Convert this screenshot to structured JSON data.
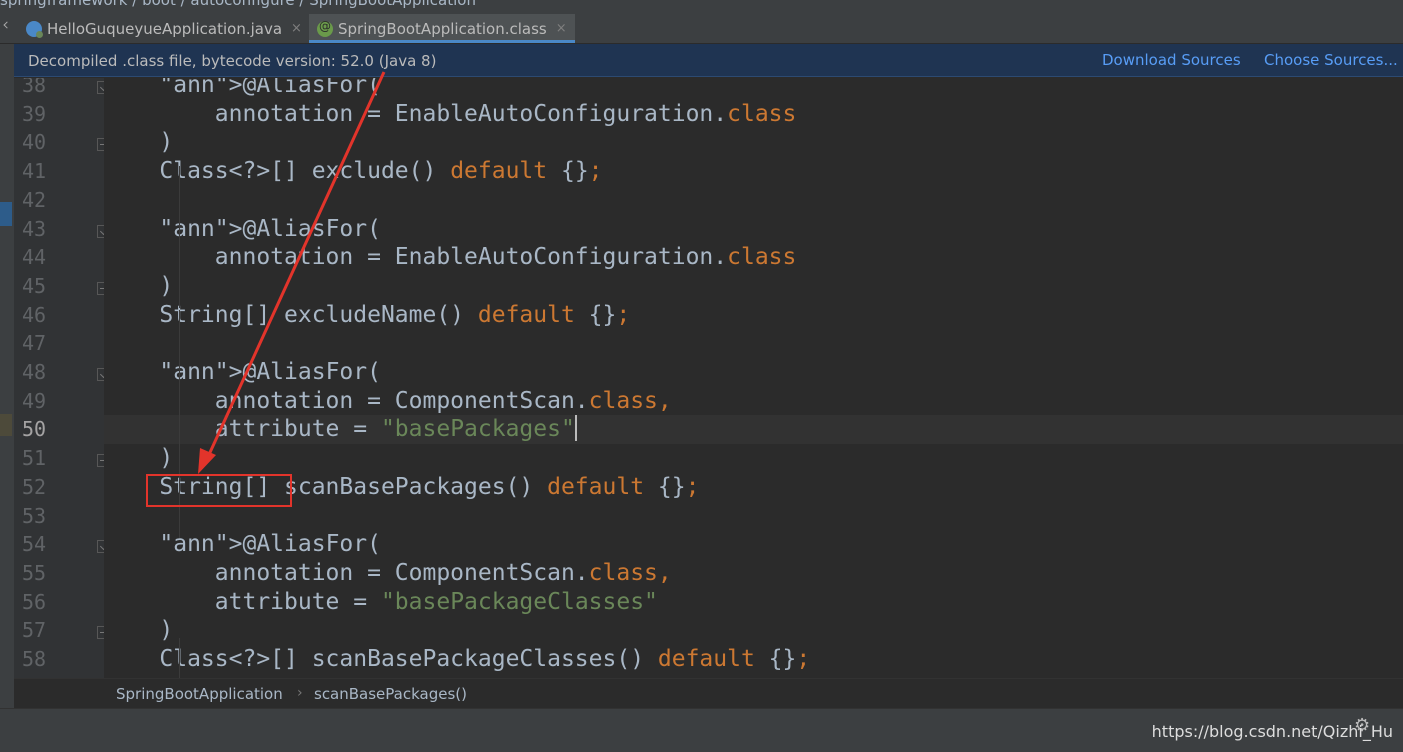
{
  "breadcrumb_top": "springframework  /  boot  /  autoconfigure  /  SpringBootApplication",
  "tabs": [
    {
      "label": "HelloGuqueyueApplication.java",
      "close": "×"
    },
    {
      "label": "SpringBootApplication.class",
      "close": "×"
    }
  ],
  "notification": {
    "message": "Decompiled .class file, bytecode version: 52.0 (Java 8)",
    "download_sources": "Download Sources",
    "choose_sources": "Choose Sources..."
  },
  "editor": {
    "current_line": 50,
    "lines": [
      {
        "n": "38",
        "t": "    @AliasFor("
      },
      {
        "n": "39",
        "t": "        annotation = EnableAutoConfiguration.class"
      },
      {
        "n": "40",
        "t": "    )"
      },
      {
        "n": "41",
        "t": "    Class<?>[] exclude() default {};"
      },
      {
        "n": "42",
        "t": ""
      },
      {
        "n": "43",
        "t": "    @AliasFor("
      },
      {
        "n": "44",
        "t": "        annotation = EnableAutoConfiguration.class"
      },
      {
        "n": "45",
        "t": "    )"
      },
      {
        "n": "46",
        "t": "    String[] excludeName() default {};"
      },
      {
        "n": "47",
        "t": ""
      },
      {
        "n": "48",
        "t": "    @AliasFor("
      },
      {
        "n": "49",
        "t": "        annotation = ComponentScan.class,"
      },
      {
        "n": "50",
        "t": "        attribute = \"basePackages\""
      },
      {
        "n": "51",
        "t": "    )"
      },
      {
        "n": "52",
        "t": "    String[] scanBasePackages() default {};"
      },
      {
        "n": "53",
        "t": ""
      },
      {
        "n": "54",
        "t": "    @AliasFor("
      },
      {
        "n": "55",
        "t": "        annotation = ComponentScan.class,"
      },
      {
        "n": "56",
        "t": "        attribute = \"basePackageClasses\""
      },
      {
        "n": "57",
        "t": "    )"
      },
      {
        "n": "58",
        "t": "    Class<?>[] scanBasePackageClasses() default {};"
      }
    ]
  },
  "breadcrumb_bottom": {
    "class_name": "SpringBootApplication",
    "separator": "›",
    "method_name": "scanBasePackages()"
  },
  "status": {
    "watermark": "https://blog.csdn.net/Qizhi_Hu"
  },
  "colors": {
    "keyword": "#cc7832",
    "string": "#6a8759",
    "annotation_highlight": "#e2342b",
    "link": "#589df6"
  },
  "icons": [
    "java-class-icon",
    "annotation-class-icon",
    "fold-marker-icon",
    "gear-icon"
  ]
}
